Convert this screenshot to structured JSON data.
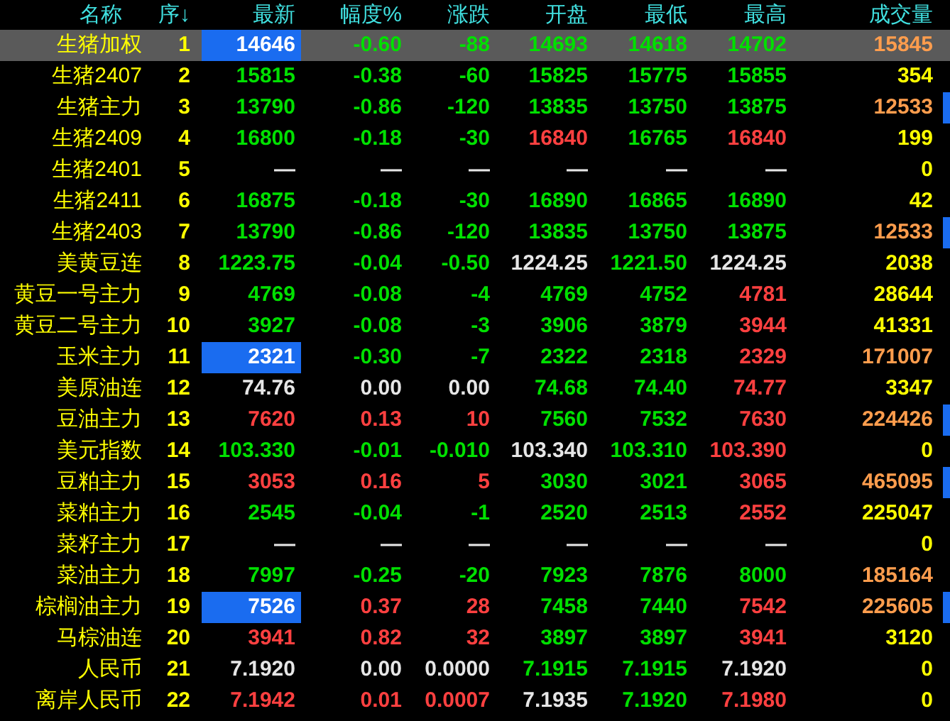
{
  "columns": [
    "名称",
    "序↓",
    "最新",
    "幅度%",
    "涨跌",
    "开盘",
    "最低",
    "最高",
    "成交量"
  ],
  "rows": [
    {
      "name": "生猪加权",
      "seq": "1",
      "selected": true,
      "marked": false,
      "highlighted": true,
      "cells": [
        {
          "text": "14646"
        },
        {
          "text": "-0.60",
          "up": false,
          "down": true
        },
        {
          "text": "-88",
          "up": false,
          "down": true
        },
        {
          "text": "14693",
          "up": false,
          "down": true
        },
        {
          "text": "14618",
          "up": false,
          "down": true
        },
        {
          "text": "14702",
          "up": false,
          "down": true
        }
      ],
      "volume": {
        "text": "15845",
        "heavy": true
      }
    },
    {
      "name": "生猪2407",
      "seq": "2",
      "selected": false,
      "marked": false,
      "highlighted": false,
      "cells": [
        {
          "text": "15815",
          "up": false,
          "down": true
        },
        {
          "text": "-0.38",
          "up": false,
          "down": true
        },
        {
          "text": "-60",
          "up": false,
          "down": true
        },
        {
          "text": "15825",
          "up": false,
          "down": true
        },
        {
          "text": "15775",
          "up": false,
          "down": true
        },
        {
          "text": "15855",
          "up": false,
          "down": true
        }
      ],
      "volume": {
        "text": "354",
        "heavy": false
      }
    },
    {
      "name": "生猪主力",
      "seq": "3",
      "selected": false,
      "marked": true,
      "highlighted": false,
      "cells": [
        {
          "text": "13790",
          "up": false,
          "down": true
        },
        {
          "text": "-0.86",
          "up": false,
          "down": true
        },
        {
          "text": "-120",
          "up": false,
          "down": true
        },
        {
          "text": "13835",
          "up": false,
          "down": true
        },
        {
          "text": "13750",
          "up": false,
          "down": true
        },
        {
          "text": "13875",
          "up": false,
          "down": true
        }
      ],
      "volume": {
        "text": "12533",
        "heavy": true
      }
    },
    {
      "name": "生猪2409",
      "seq": "4",
      "selected": false,
      "marked": false,
      "highlighted": false,
      "cells": [
        {
          "text": "16800",
          "up": false,
          "down": true
        },
        {
          "text": "-0.18",
          "up": false,
          "down": true
        },
        {
          "text": "-30",
          "up": false,
          "down": true
        },
        {
          "text": "16840",
          "up": true,
          "down": false
        },
        {
          "text": "16765",
          "up": false,
          "down": true
        },
        {
          "text": "16840",
          "up": true,
          "down": false
        }
      ],
      "volume": {
        "text": "199",
        "heavy": false
      }
    },
    {
      "name": "生猪2401",
      "seq": "5",
      "selected": false,
      "marked": false,
      "highlighted": false,
      "cells": [
        {
          "text": "—",
          "up": false,
          "down": false
        },
        {
          "text": "—",
          "up": false,
          "down": false
        },
        {
          "text": "—",
          "up": false,
          "down": false
        },
        {
          "text": "—",
          "up": false,
          "down": false
        },
        {
          "text": "—",
          "up": false,
          "down": false
        },
        {
          "text": "—",
          "up": false,
          "down": false
        }
      ],
      "volume": {
        "text": "0",
        "heavy": false
      }
    },
    {
      "name": "生猪2411",
      "seq": "6",
      "selected": false,
      "marked": false,
      "highlighted": false,
      "cells": [
        {
          "text": "16875",
          "up": false,
          "down": true
        },
        {
          "text": "-0.18",
          "up": false,
          "down": true
        },
        {
          "text": "-30",
          "up": false,
          "down": true
        },
        {
          "text": "16890",
          "up": false,
          "down": true
        },
        {
          "text": "16865",
          "up": false,
          "down": true
        },
        {
          "text": "16890",
          "up": false,
          "down": true
        }
      ],
      "volume": {
        "text": "42",
        "heavy": false
      }
    },
    {
      "name": "生猪2403",
      "seq": "7",
      "selected": false,
      "marked": true,
      "highlighted": false,
      "cells": [
        {
          "text": "13790",
          "up": false,
          "down": true
        },
        {
          "text": "-0.86",
          "up": false,
          "down": true
        },
        {
          "text": "-120",
          "up": false,
          "down": true
        },
        {
          "text": "13835",
          "up": false,
          "down": true
        },
        {
          "text": "13750",
          "up": false,
          "down": true
        },
        {
          "text": "13875",
          "up": false,
          "down": true
        }
      ],
      "volume": {
        "text": "12533",
        "heavy": true
      }
    },
    {
      "name": "美黄豆连",
      "seq": "8",
      "selected": false,
      "marked": false,
      "highlighted": false,
      "cells": [
        {
          "text": "1223.75",
          "up": false,
          "down": true
        },
        {
          "text": "-0.04",
          "up": false,
          "down": true
        },
        {
          "text": "-0.50",
          "up": false,
          "down": true
        },
        {
          "text": "1224.25",
          "up": false,
          "down": false
        },
        {
          "text": "1221.50",
          "up": false,
          "down": true
        },
        {
          "text": "1224.25",
          "up": false,
          "down": false
        }
      ],
      "volume": {
        "text": "2038",
        "heavy": false
      }
    },
    {
      "name": "黄豆一号主力",
      "seq": "9",
      "selected": false,
      "marked": false,
      "highlighted": false,
      "cells": [
        {
          "text": "4769",
          "up": false,
          "down": true
        },
        {
          "text": "-0.08",
          "up": false,
          "down": true
        },
        {
          "text": "-4",
          "up": false,
          "down": true
        },
        {
          "text": "4769",
          "up": false,
          "down": true
        },
        {
          "text": "4752",
          "up": false,
          "down": true
        },
        {
          "text": "4781",
          "up": true,
          "down": false
        }
      ],
      "volume": {
        "text": "28644",
        "heavy": false
      }
    },
    {
      "name": "黄豆二号主力",
      "seq": "10",
      "selected": false,
      "marked": false,
      "highlighted": false,
      "cells": [
        {
          "text": "3927",
          "up": false,
          "down": true
        },
        {
          "text": "-0.08",
          "up": false,
          "down": true
        },
        {
          "text": "-3",
          "up": false,
          "down": true
        },
        {
          "text": "3906",
          "up": false,
          "down": true
        },
        {
          "text": "3879",
          "up": false,
          "down": true
        },
        {
          "text": "3944",
          "up": true,
          "down": false
        }
      ],
      "volume": {
        "text": "41331",
        "heavy": false
      }
    },
    {
      "name": "玉米主力",
      "seq": "11",
      "selected": false,
      "marked": false,
      "highlighted": true,
      "cells": [
        {
          "text": "2321"
        },
        {
          "text": "-0.30",
          "up": false,
          "down": true
        },
        {
          "text": "-7",
          "up": false,
          "down": true
        },
        {
          "text": "2322",
          "up": false,
          "down": true
        },
        {
          "text": "2318",
          "up": false,
          "down": true
        },
        {
          "text": "2329",
          "up": true,
          "down": false
        }
      ],
      "volume": {
        "text": "171007",
        "heavy": true
      }
    },
    {
      "name": "美原油连",
      "seq": "12",
      "selected": false,
      "marked": false,
      "highlighted": false,
      "cells": [
        {
          "text": "74.76",
          "up": false,
          "down": false
        },
        {
          "text": "0.00",
          "up": false,
          "down": false
        },
        {
          "text": "0.00",
          "up": false,
          "down": false
        },
        {
          "text": "74.68",
          "up": false,
          "down": true
        },
        {
          "text": "74.40",
          "up": false,
          "down": true
        },
        {
          "text": "74.77",
          "up": true,
          "down": false
        }
      ],
      "volume": {
        "text": "3347",
        "heavy": false
      }
    },
    {
      "name": "豆油主力",
      "seq": "13",
      "selected": false,
      "marked": true,
      "highlighted": false,
      "cells": [
        {
          "text": "7620",
          "up": true,
          "down": false
        },
        {
          "text": "0.13",
          "up": true,
          "down": false
        },
        {
          "text": "10",
          "up": true,
          "down": false
        },
        {
          "text": "7560",
          "up": false,
          "down": true
        },
        {
          "text": "7532",
          "up": false,
          "down": true
        },
        {
          "text": "7630",
          "up": true,
          "down": false
        }
      ],
      "volume": {
        "text": "224426",
        "heavy": true
      }
    },
    {
      "name": "美元指数",
      "seq": "14",
      "selected": false,
      "marked": false,
      "highlighted": false,
      "cells": [
        {
          "text": "103.330",
          "up": false,
          "down": true
        },
        {
          "text": "-0.01",
          "up": false,
          "down": true
        },
        {
          "text": "-0.010",
          "up": false,
          "down": true
        },
        {
          "text": "103.340",
          "up": false,
          "down": false
        },
        {
          "text": "103.310",
          "up": false,
          "down": true
        },
        {
          "text": "103.390",
          "up": true,
          "down": false
        }
      ],
      "volume": {
        "text": "0",
        "heavy": false
      }
    },
    {
      "name": "豆粕主力",
      "seq": "15",
      "selected": false,
      "marked": true,
      "highlighted": false,
      "cells": [
        {
          "text": "3053",
          "up": true,
          "down": false
        },
        {
          "text": "0.16",
          "up": true,
          "down": false
        },
        {
          "text": "5",
          "up": true,
          "down": false
        },
        {
          "text": "3030",
          "up": false,
          "down": true
        },
        {
          "text": "3021",
          "up": false,
          "down": true
        },
        {
          "text": "3065",
          "up": true,
          "down": false
        }
      ],
      "volume": {
        "text": "465095",
        "heavy": true
      }
    },
    {
      "name": "菜粕主力",
      "seq": "16",
      "selected": false,
      "marked": false,
      "highlighted": false,
      "cells": [
        {
          "text": "2545",
          "up": false,
          "down": true
        },
        {
          "text": "-0.04",
          "up": false,
          "down": true
        },
        {
          "text": "-1",
          "up": false,
          "down": true
        },
        {
          "text": "2520",
          "up": false,
          "down": true
        },
        {
          "text": "2513",
          "up": false,
          "down": true
        },
        {
          "text": "2552",
          "up": true,
          "down": false
        }
      ],
      "volume": {
        "text": "225047",
        "heavy": false
      }
    },
    {
      "name": "菜籽主力",
      "seq": "17",
      "selected": false,
      "marked": false,
      "highlighted": false,
      "cells": [
        {
          "text": "—",
          "up": false,
          "down": false
        },
        {
          "text": "—",
          "up": false,
          "down": false
        },
        {
          "text": "—",
          "up": false,
          "down": false
        },
        {
          "text": "—",
          "up": false,
          "down": false
        },
        {
          "text": "—",
          "up": false,
          "down": false
        },
        {
          "text": "—",
          "up": false,
          "down": false
        }
      ],
      "volume": {
        "text": "0",
        "heavy": false
      }
    },
    {
      "name": "菜油主力",
      "seq": "18",
      "selected": false,
      "marked": false,
      "highlighted": false,
      "cells": [
        {
          "text": "7997",
          "up": false,
          "down": true
        },
        {
          "text": "-0.25",
          "up": false,
          "down": true
        },
        {
          "text": "-20",
          "up": false,
          "down": true
        },
        {
          "text": "7923",
          "up": false,
          "down": true
        },
        {
          "text": "7876",
          "up": false,
          "down": true
        },
        {
          "text": "8000",
          "up": false,
          "down": true
        }
      ],
      "volume": {
        "text": "185164",
        "heavy": true
      }
    },
    {
      "name": "棕榈油主力",
      "seq": "19",
      "selected": false,
      "marked": true,
      "highlighted": true,
      "cells": [
        {
          "text": "7526"
        },
        {
          "text": "0.37",
          "up": true,
          "down": false
        },
        {
          "text": "28",
          "up": true,
          "down": false
        },
        {
          "text": "7458",
          "up": false,
          "down": true
        },
        {
          "text": "7440",
          "up": false,
          "down": true
        },
        {
          "text": "7542",
          "up": true,
          "down": false
        }
      ],
      "volume": {
        "text": "225605",
        "heavy": true
      }
    },
    {
      "name": "马棕油连",
      "seq": "20",
      "selected": false,
      "marked": false,
      "highlighted": false,
      "cells": [
        {
          "text": "3941",
          "up": true,
          "down": false
        },
        {
          "text": "0.82",
          "up": true,
          "down": false
        },
        {
          "text": "32",
          "up": true,
          "down": false
        },
        {
          "text": "3897",
          "up": false,
          "down": true
        },
        {
          "text": "3897",
          "up": false,
          "down": true
        },
        {
          "text": "3941",
          "up": true,
          "down": false
        }
      ],
      "volume": {
        "text": "3120",
        "heavy": false
      }
    },
    {
      "name": "人民币",
      "seq": "21",
      "selected": false,
      "marked": false,
      "highlighted": false,
      "cells": [
        {
          "text": "7.1920",
          "up": false,
          "down": false
        },
        {
          "text": "0.00",
          "up": false,
          "down": false
        },
        {
          "text": "0.0000",
          "up": false,
          "down": false
        },
        {
          "text": "7.1915",
          "up": false,
          "down": true
        },
        {
          "text": "7.1915",
          "up": false,
          "down": true
        },
        {
          "text": "7.1920",
          "up": false,
          "down": false
        }
      ],
      "volume": {
        "text": "0",
        "heavy": false
      }
    },
    {
      "name": "离岸人民币",
      "seq": "22",
      "selected": false,
      "marked": false,
      "highlighted": false,
      "cells": [
        {
          "text": "7.1942",
          "up": true,
          "down": false
        },
        {
          "text": "0.01",
          "up": true,
          "down": false
        },
        {
          "text": "0.0007",
          "up": true,
          "down": false
        },
        {
          "text": "7.1935",
          "up": false,
          "down": false
        },
        {
          "text": "7.1920",
          "up": false,
          "down": true
        },
        {
          "text": "7.1980",
          "up": true,
          "down": false
        }
      ],
      "volume": {
        "text": "0",
        "heavy": false
      }
    }
  ]
}
